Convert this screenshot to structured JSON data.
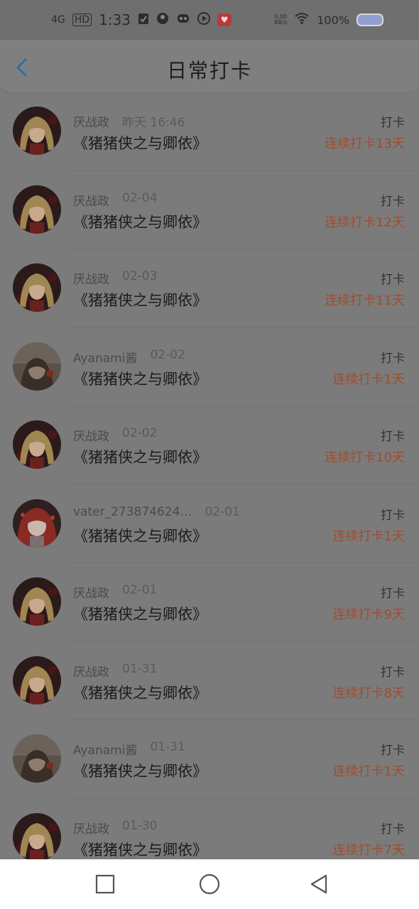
{
  "status": {
    "network": "4G",
    "hd": "HD",
    "time": "1:33",
    "speed_value": "0.00",
    "speed_unit": "KB/s",
    "battery": "100%"
  },
  "header": {
    "title": "日常打卡"
  },
  "rows": [
    {
      "user": "厌战政",
      "date": "昨天 16:46",
      "book": "《猪猪侠之与卿依》",
      "tag": "打卡",
      "streak": "连续打卡13天",
      "avatar": "blonde"
    },
    {
      "user": "厌战政",
      "date": "02-04",
      "book": "《猪猪侠之与卿依》",
      "tag": "打卡",
      "streak": "连续打卡12天",
      "avatar": "blonde"
    },
    {
      "user": "厌战政",
      "date": "02-03",
      "book": "《猪猪侠之与卿依》",
      "tag": "打卡",
      "streak": "连续打卡11天",
      "avatar": "blonde"
    },
    {
      "user": "Ayanami酱",
      "date": "02-02",
      "book": "《猪猪侠之与卿依》",
      "tag": "打卡",
      "streak": "连续打卡1天",
      "avatar": "brown"
    },
    {
      "user": "厌战政",
      "date": "02-02",
      "book": "《猪猪侠之与卿依》",
      "tag": "打卡",
      "streak": "连续打卡10天",
      "avatar": "blonde"
    },
    {
      "user": "vater_273874624…",
      "date": "02-01",
      "book": "《猪猪侠之与卿依》",
      "tag": "打卡",
      "streak": "连续打卡1天",
      "avatar": "red"
    },
    {
      "user": "厌战政",
      "date": "02-01",
      "book": "《猪猪侠之与卿依》",
      "tag": "打卡",
      "streak": "连续打卡9天",
      "avatar": "blonde"
    },
    {
      "user": "厌战政",
      "date": "01-31",
      "book": "《猪猪侠之与卿依》",
      "tag": "打卡",
      "streak": "连续打卡8天",
      "avatar": "blonde"
    },
    {
      "user": "Ayanami酱",
      "date": "01-31",
      "book": "《猪猪侠之与卿依》",
      "tag": "打卡",
      "streak": "连续打卡1天",
      "avatar": "brown"
    },
    {
      "user": "厌战政",
      "date": "01-30",
      "book": "《猪猪侠之与卿依》",
      "tag": "打卡",
      "streak": "连续打卡7天",
      "avatar": "blonde"
    }
  ],
  "colors": {
    "streak": "#a24c2b",
    "back": "#2b6fa7"
  },
  "icons": {
    "back": "chevron-left-icon",
    "nav_recent": "square-icon",
    "nav_home": "circle-icon",
    "nav_back": "triangle-back-icon"
  }
}
